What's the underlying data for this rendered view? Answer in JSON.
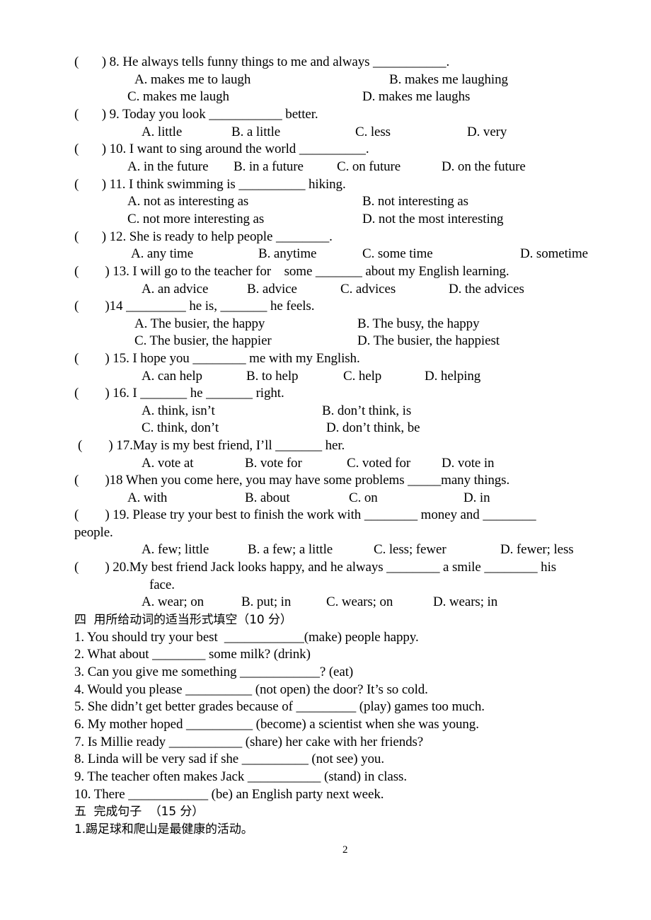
{
  "page_number": "2",
  "mc": {
    "q8": {
      "stem": "(       ) 8. He always tells funny things to me and always ___________.",
      "A": "A. makes me to laugh",
      "B": "B. makes me laughing",
      "C": "C. makes me laugh",
      "D": "D. makes me laughs"
    },
    "q9": {
      "stem": "(       ) 9. Today you look ___________ better.",
      "A": "A. little",
      "B": "B. a little",
      "C": "C. less",
      "D": "D. very"
    },
    "q10": {
      "stem": "(       ) 10. I want to sing around the world __________.",
      "A": "A. in the future",
      "B": "B. in a future",
      "C": "C. on future",
      "D": "D. on the future"
    },
    "q11": {
      "stem": "(       ) 11. I think swimming is __________ hiking.",
      "A": "A. not as interesting as",
      "B": "B. not interesting as",
      "C": "C. not more interesting as",
      "D": "D. not the most interesting"
    },
    "q12": {
      "stem": "(       ) 12. She is ready to help people ________.",
      "A": "A. any time",
      "B": "B. anytime",
      "C": "C. some time",
      "D": "D. sometime"
    },
    "q13": {
      "stem": "(        ) 13. I will go to the teacher for    some _______ about my English learning.",
      "A": "A. an advice",
      "B": "B. advice",
      "C": "C. advices",
      "D": "D. the advices"
    },
    "q14": {
      "stem": "(        )14 _________ he is, _______ he feels.",
      "A": "A. The busier, the happy",
      "B": "B. The busy, the happy",
      "C": "C. The busier, the happier",
      "D": "D. The busier, the happiest"
    },
    "q15": {
      "stem": "(        ) 15. I hope you ________ me with my English.",
      "A": "A. can help",
      "B": "B. to help",
      "C": "C. help",
      "D": "D. helping"
    },
    "q16": {
      "stem": "(        ) 16. I _______ he _______ right.",
      "A": "A. think, isn’t",
      "B": "B. don’t think, is",
      "C": "C. think, don’t",
      "D": "D. don’t think, be"
    },
    "q17": {
      "stem": "(        ) 17.May is my best friend, I’ll _______ her.",
      "A": "A. vote at",
      "B": "B. vote for",
      "C": "C. voted for",
      "D": "D. vote in"
    },
    "q18": {
      "stem": "(        )18 When you come here, you may have some problems _____many things.",
      "A": "A. with",
      "B": "B. about",
      "C": "C. on",
      "D": "D. in"
    },
    "q19": {
      "stem": "(        ) 19. Please try your best to finish the work with ________ money and ________",
      "stem_cont": "people.",
      "A": "A. few; little",
      "B": "B. a few; a little",
      "C": "C. less; fewer",
      "D": "D. fewer; less"
    },
    "q20": {
      "stem": "(        ) 20.My best friend Jack looks happy, and he always ________ a smile ________ his",
      "stem_cont": "face.",
      "A": "A. wear; on",
      "B": "B. put; in",
      "C": "C. wears; on",
      "D": "D. wears; in"
    }
  },
  "section4": {
    "heading": "四  用所给动词的适当形式填空（10 分）",
    "items": [
      "1. You should try your best  ____________(make) people happy.",
      "2. What about ________ some milk? (drink)",
      "3. Can you give me something ____________? (eat)",
      "4. Would you please __________ (not open) the door? It’s so cold.",
      "5. She didn’t get better grades because of _________ (play) games too much.",
      "6. My mother hoped __________ (become) a scientist when she was young.",
      "7. Is Millie ready ___________ (share) her cake with her friends?",
      "8. Linda will be very sad if she __________ (not see) you.",
      "9. The teacher often makes Jack ___________ (stand) in class.",
      "10. There ____________ (be) an English party next week."
    ]
  },
  "section5": {
    "heading": "五  完成句子  （15 分）",
    "items": [
      "1.踢足球和爬山是最健康的活动。"
    ]
  }
}
